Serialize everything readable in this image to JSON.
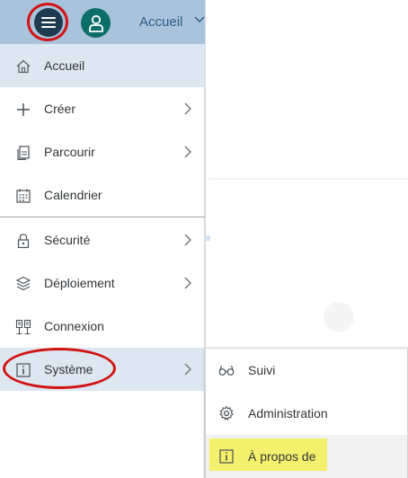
{
  "header": {
    "title": "Accueil",
    "menu_icon": "hamburger-menu-icon",
    "avatar_icon": "user-avatar-icon",
    "colors": {
      "header_bg": "#a9c3dd",
      "menu_button": "#1e3b50",
      "avatar": "#0b6f68",
      "title": "#2d5d82"
    }
  },
  "sidebar": {
    "items": [
      {
        "label": "Accueil",
        "icon": "home-icon",
        "selected": true,
        "has_submenu": false
      },
      {
        "label": "Créer",
        "icon": "plus-icon",
        "selected": false,
        "has_submenu": true
      },
      {
        "label": "Parcourir",
        "icon": "documents-icon",
        "selected": false,
        "has_submenu": true
      },
      {
        "label": "Calendrier",
        "icon": "calendar-icon",
        "selected": false,
        "has_submenu": false
      },
      {
        "label": "Sécurité",
        "icon": "lock-icon",
        "selected": false,
        "has_submenu": true
      },
      {
        "label": "Déploiement",
        "icon": "cube-stack-icon",
        "selected": false,
        "has_submenu": true
      },
      {
        "label": "Connexion",
        "icon": "connection-icon",
        "selected": false,
        "has_submenu": false
      },
      {
        "label": "Système",
        "icon": "info-box-icon",
        "selected": false,
        "has_submenu": true,
        "expanded": true
      }
    ]
  },
  "submenu": {
    "items": [
      {
        "label": "Suivi",
        "icon": "glasses-icon"
      },
      {
        "label": "Administration",
        "icon": "gear-icon"
      },
      {
        "label": "À propos de",
        "icon": "info-box-icon",
        "highlighted": true
      }
    ]
  },
  "annotations": {
    "circle_color": "#d21313",
    "highlight_color": "#f3f16b"
  }
}
